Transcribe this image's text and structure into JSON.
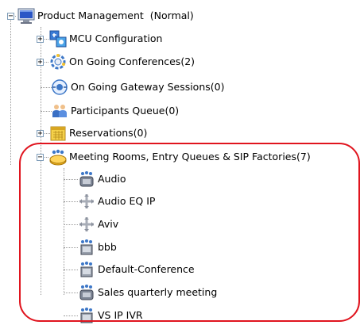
{
  "tree": {
    "root": {
      "label": "Product Management",
      "status": "(Normal)",
      "icon": "computer-icon",
      "expanded": true
    },
    "children": [
      {
        "label": "MCU Configuration",
        "icon": "configuration-icon",
        "expandable": true,
        "expanded": false
      },
      {
        "label": "On Going Conferences(2)",
        "icon": "conference-gear-icon",
        "expandable": true,
        "expanded": false
      },
      {
        "label": "On Going Gateway Sessions(0)",
        "icon": "gateway-icon",
        "expandable": false
      },
      {
        "label": "Participants Queue(0)",
        "icon": "participants-icon",
        "expandable": false
      },
      {
        "label": "Reservations(0)",
        "icon": "calendar-icon",
        "expandable": true,
        "expanded": false
      },
      {
        "label": "Meeting Rooms, Entry Queues & SIP Factories(7)",
        "icon": "meeting-rooms-icon",
        "expandable": true,
        "expanded": true,
        "items": [
          {
            "label": "Audio",
            "icon": "audio-room-icon"
          },
          {
            "label": "Audio EQ IP",
            "icon": "entry-queue-icon"
          },
          {
            "label": "Aviv",
            "icon": "entry-queue-icon"
          },
          {
            "label": "bbb",
            "icon": "video-room-icon"
          },
          {
            "label": "Default-Conference",
            "icon": "video-room-icon"
          },
          {
            "label": "Sales quarterly meeting",
            "icon": "audio-room-icon"
          },
          {
            "label": "VS IP IVR",
            "icon": "video-room-icon"
          }
        ]
      }
    ]
  },
  "highlight_color": "#e0141e",
  "connector_color": "#9a9a9a"
}
